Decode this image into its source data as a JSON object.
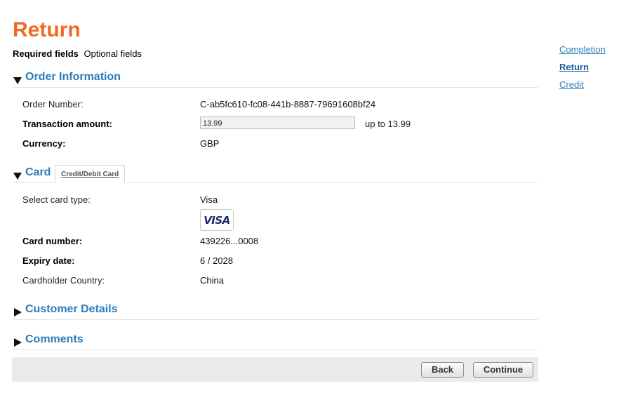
{
  "header": {
    "title": "Return",
    "required_label": "Required fields",
    "optional_label": "Optional fields"
  },
  "side_nav": {
    "items": [
      {
        "label": "Completion",
        "active": false
      },
      {
        "label": "Return",
        "active": true
      },
      {
        "label": "Credit",
        "active": false
      }
    ]
  },
  "order": {
    "title": "Order Information",
    "order_number_label": "Order Number:",
    "order_number": "C-ab5fc610-fc08-441b-8887-79691608bf24",
    "amount_label": "Transaction amount:",
    "amount_value": "13.99",
    "amount_limit": "up to 13.99",
    "currency_label": "Currency:",
    "currency": "GBP"
  },
  "card": {
    "title": "Card",
    "tab_label": "Credit/Debit Card",
    "card_type_label": "Select card type:",
    "card_type": "Visa",
    "card_logo_text": "VISA",
    "card_number_label": "Card number:",
    "card_number": "439226...0008",
    "expiry_label": "Expiry date:",
    "expiry": "6 / 2028",
    "country_label": "Cardholder Country:",
    "country": "China"
  },
  "customer": {
    "title": "Customer Details"
  },
  "comments": {
    "title": "Comments"
  },
  "actions": {
    "back_label": "Back",
    "continue_label": "Continue"
  },
  "colors": {
    "title": "#f26a21",
    "link": "#2b7bb9",
    "footer_bg": "#ebebeb"
  }
}
